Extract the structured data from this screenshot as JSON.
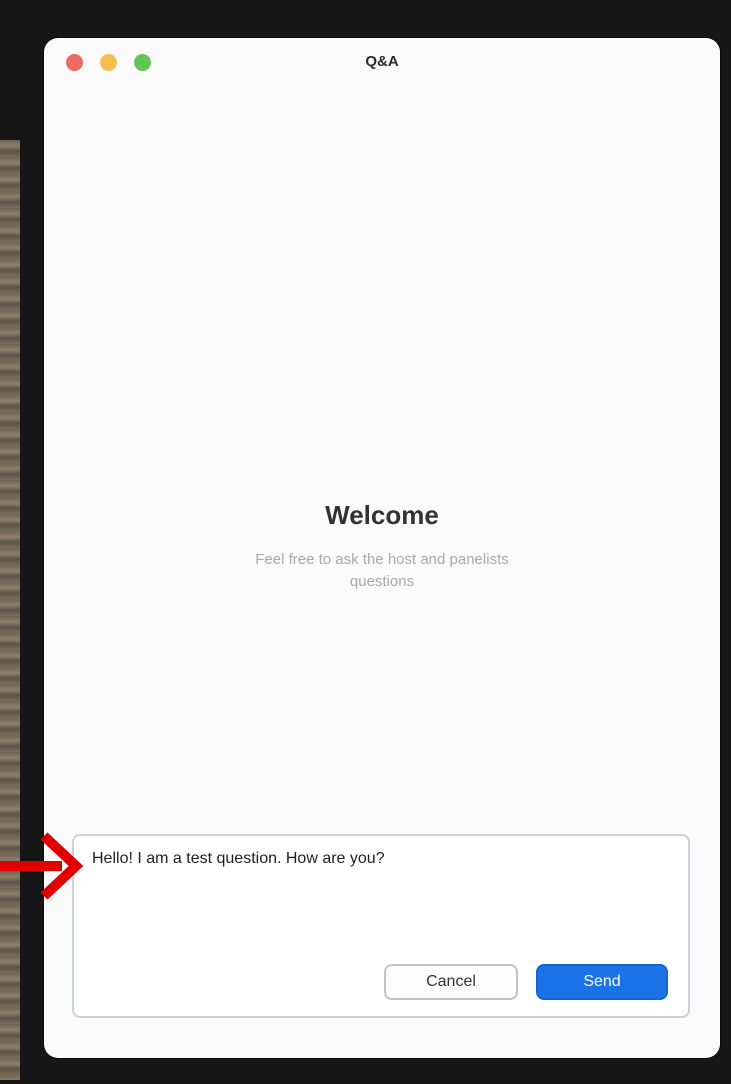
{
  "window": {
    "title": "Q&A"
  },
  "welcome": {
    "title": "Welcome",
    "subtitle": "Feel free to ask the host and panelists questions"
  },
  "composer": {
    "question_value": "Hello! I am a test question. How are you?",
    "cancel_label": "Cancel",
    "send_label": "Send"
  },
  "annotation": {
    "arrow_icon": "arrow-right-icon",
    "arrow_color": "#e10000"
  },
  "colors": {
    "accent": "#1a73e8",
    "close": "#ec6a5e",
    "minimize": "#f4be4f",
    "maximize": "#61c554"
  }
}
